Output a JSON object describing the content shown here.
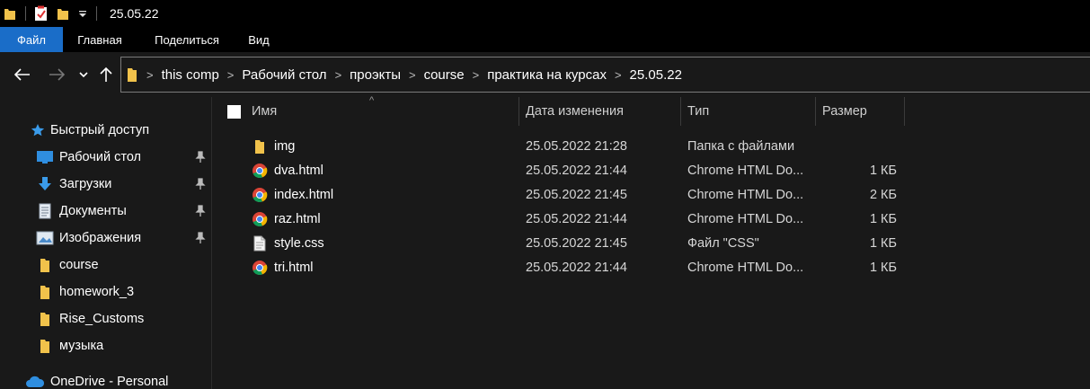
{
  "window": {
    "title": "25.05.22"
  },
  "ribbon": {
    "tabs": [
      "Файл",
      "Главная",
      "Поделиться",
      "Вид"
    ]
  },
  "address": {
    "crumbs": [
      "this comp",
      "Рабочий стол",
      "проэкты",
      "course",
      "практика на курсах",
      "25.05.22"
    ]
  },
  "sidebar": {
    "quick_access_label": "Быстрый доступ",
    "items": [
      {
        "label": "Рабочий стол",
        "icon": "desktop-icon",
        "pinned": true
      },
      {
        "label": "Загрузки",
        "icon": "downloads-icon",
        "pinned": true
      },
      {
        "label": "Документы",
        "icon": "documents-icon",
        "pinned": true
      },
      {
        "label": "Изображения",
        "icon": "pictures-icon",
        "pinned": true
      },
      {
        "label": "course",
        "icon": "folder-icon",
        "pinned": false
      },
      {
        "label": "homework_3",
        "icon": "folder-icon",
        "pinned": false
      },
      {
        "label": "Rise_Customs",
        "icon": "folder-icon",
        "pinned": false
      },
      {
        "label": "музыка",
        "icon": "folder-icon",
        "pinned": false
      }
    ],
    "onedrive_label": "OneDrive - Personal"
  },
  "columns": {
    "name": "Имя",
    "date": "Дата изменения",
    "type": "Тип",
    "size": "Размер"
  },
  "files": [
    {
      "name": "img",
      "icon": "folder-icon",
      "date": "25.05.2022 21:28",
      "type": "Папка с файлами",
      "size": ""
    },
    {
      "name": "dva.html",
      "icon": "chrome-icon",
      "date": "25.05.2022 21:44",
      "type": "Chrome HTML Do...",
      "size": "1 КБ"
    },
    {
      "name": "index.html",
      "icon": "chrome-icon",
      "date": "25.05.2022 21:45",
      "type": "Chrome HTML Do...",
      "size": "2 КБ"
    },
    {
      "name": "raz.html",
      "icon": "chrome-icon",
      "date": "25.05.2022 21:44",
      "type": "Chrome HTML Do...",
      "size": "1 КБ"
    },
    {
      "name": "style.css",
      "icon": "document-icon",
      "date": "25.05.2022 21:45",
      "type": "Файл \"CSS\"",
      "size": "1 КБ"
    },
    {
      "name": "tri.html",
      "icon": "chrome-icon",
      "date": "25.05.2022 21:44",
      "type": "Chrome HTML Do...",
      "size": "1 КБ"
    }
  ],
  "colors": {
    "accent": "#1a6dc8",
    "folder": "#f1c24b",
    "background": "#191919"
  }
}
